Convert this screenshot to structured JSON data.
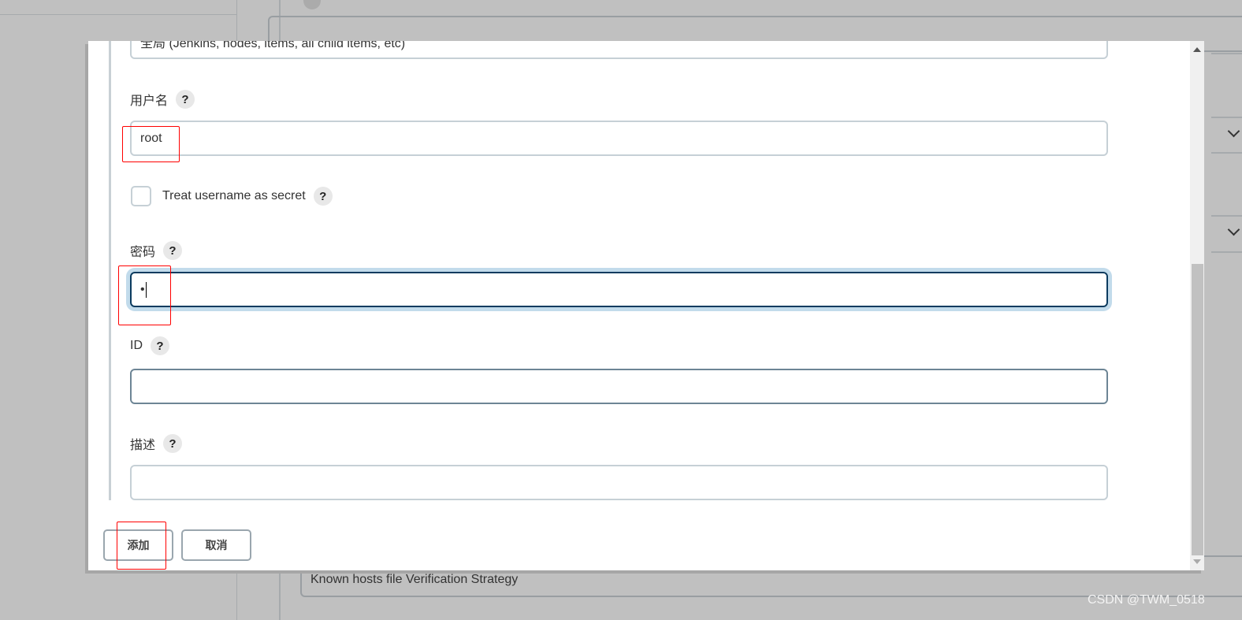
{
  "background": {
    "strategy_select": "Known hosts file Verification Strategy"
  },
  "dialog": {
    "scope_select": "全局 (Jenkins, nodes, items, all child items, etc)",
    "username_label": "用户名",
    "username_value": "root",
    "treat_secret_label": "Treat username as secret",
    "treat_secret_checked": false,
    "password_label": "密码",
    "password_value": "•",
    "id_label": "ID",
    "id_value": "",
    "description_label": "描述",
    "description_value": "",
    "help_glyph": "?",
    "add_button": "添加",
    "cancel_button": "取消"
  },
  "watermark": "CSDN @TWM_0518",
  "colors": {
    "focus": "#0b3b5f",
    "focus_ring": "#c2dbeb",
    "annotation": "#ff0000"
  }
}
